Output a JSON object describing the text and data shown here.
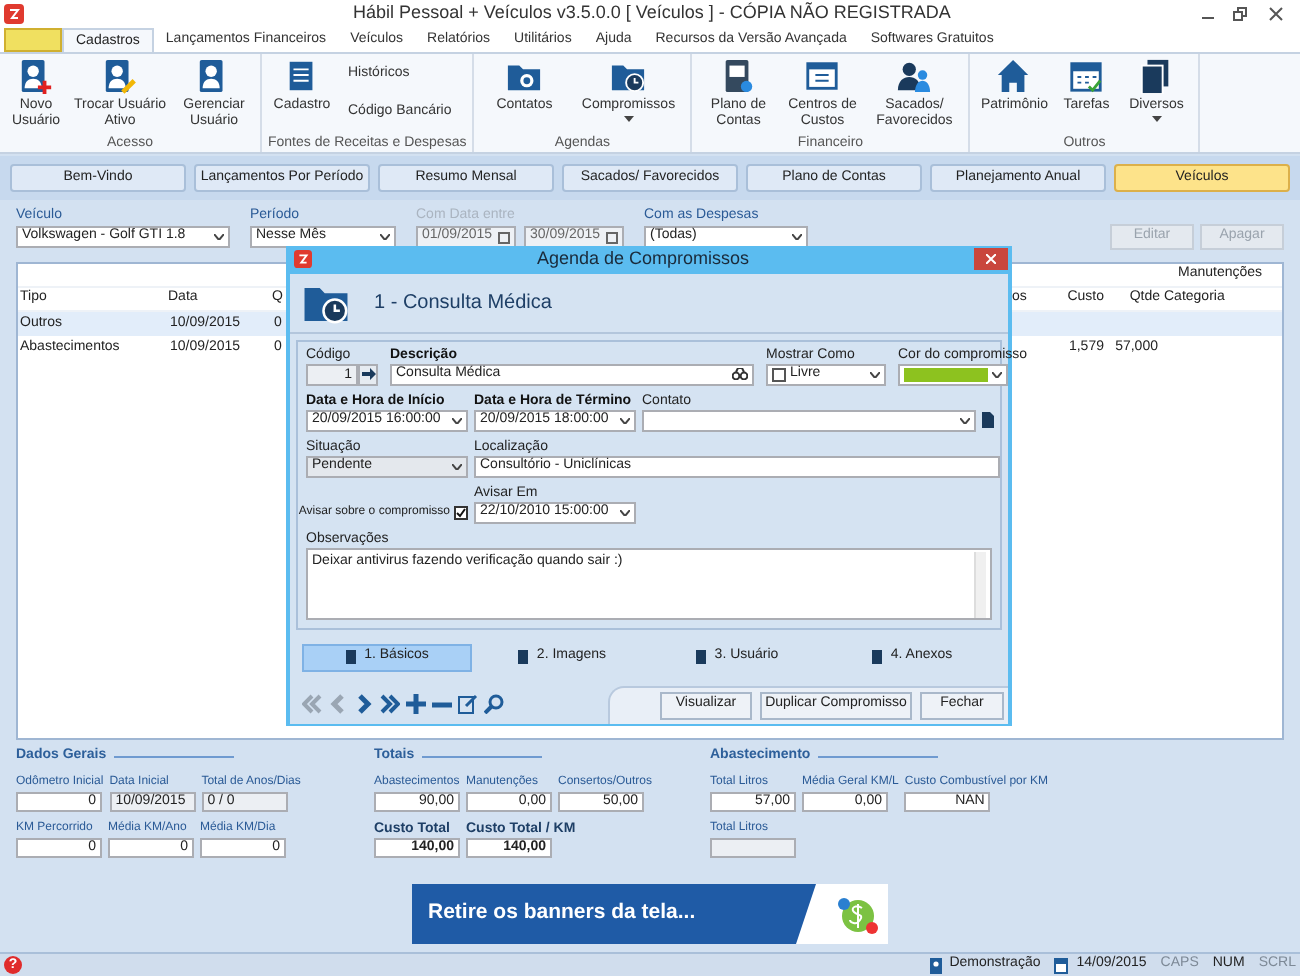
{
  "window": {
    "title": "Hábil Pessoal + Veículos v3.5.0.0 [ Veículos ] - CÓPIA NÃO REGISTRADA"
  },
  "ribbon_tabs": [
    {
      "label": "Cadastros",
      "selected": true
    },
    {
      "label": "Lançamentos Financeiros",
      "selected": false
    },
    {
      "label": "Veículos",
      "selected": false
    },
    {
      "label": "Relatórios",
      "selected": false
    },
    {
      "label": "Utilitários",
      "selected": false
    },
    {
      "label": "Ajuda",
      "selected": false
    },
    {
      "label": "Recursos da Versão Avançada",
      "selected": false
    },
    {
      "label": "Softwares Gratuitos",
      "selected": false
    }
  ],
  "ribbon_groups": [
    {
      "label": "Acesso",
      "buttons": [
        {
          "label": "Novo Usuário",
          "dropdown": false
        },
        {
          "label": "Trocar Usuário Ativo",
          "dropdown": false
        },
        {
          "label": "Gerenciar Usuário",
          "dropdown": false
        }
      ]
    },
    {
      "label": "Fontes de Receitas e Despesas",
      "buttons": [
        {
          "label": "Cadastro",
          "dropdown": false
        }
      ],
      "small_buttons": [
        "Históricos",
        "Código Bancário"
      ]
    },
    {
      "label": "Agendas",
      "buttons": [
        {
          "label": "Contatos",
          "dropdown": false
        },
        {
          "label": "Compromissos",
          "dropdown": true
        }
      ]
    },
    {
      "label": "Financeiro",
      "buttons": [
        {
          "label": "Plano de Contas",
          "dropdown": false
        },
        {
          "label": "Centros de Custos",
          "dropdown": false
        },
        {
          "label": "Sacados/ Favorecidos",
          "dropdown": false
        }
      ]
    },
    {
      "label": "Outros",
      "buttons": [
        {
          "label": "Patrimônio",
          "dropdown": false
        },
        {
          "label": "Tarefas",
          "dropdown": false
        },
        {
          "label": "Diversos",
          "dropdown": true
        }
      ]
    }
  ],
  "nav_buttons": [
    {
      "label": "Bem-Vindo",
      "selected": false
    },
    {
      "label": "Lançamentos Por Período",
      "selected": false
    },
    {
      "label": "Resumo Mensal",
      "selected": false
    },
    {
      "label": "Sacados/ Favorecidos",
      "selected": false
    },
    {
      "label": "Plano de Contas",
      "selected": false
    },
    {
      "label": "Planejamento Anual",
      "selected": false
    },
    {
      "label": "Veículos",
      "selected": true
    }
  ],
  "filters": {
    "vehicle": {
      "label": "Veículo",
      "value": "Volkswagen - Golf GTI 1.8"
    },
    "period": {
      "label": "Período",
      "value": "Nesse Mês"
    },
    "date_range": {
      "label": "Com Data entre",
      "disabled": true,
      "from": "01/09/2015",
      "to": "30/09/2015"
    },
    "expenses": {
      "label": "Com as Despesas",
      "value": "(Todas)"
    }
  },
  "actions": [
    {
      "label": "Editar",
      "disabled": true
    },
    {
      "label": "Apagar",
      "disabled": true
    }
  ],
  "table": {
    "group_header": "Manutenções",
    "columns": {
      "tipo": "Tipo",
      "data": "Data",
      "column_3": "Q",
      "column_4": "os",
      "custo": "Custo",
      "qtde": "Qtde",
      "categoria": "Categoria"
    },
    "rows": [
      {
        "selected": true,
        "tipo": "Outros",
        "data": "10/09/2015",
        "column_3": "0"
      },
      {
        "selected": false,
        "tipo": "Abastecimentos",
        "data": "10/09/2015",
        "column_3": "0",
        "custo": "1,579",
        "qtde": "57,000"
      }
    ]
  },
  "dialog": {
    "title": "Agenda de Compromissos",
    "heading": "1 - Consulta Médica",
    "codigo": {
      "label": "Código",
      "value": "1"
    },
    "descricao": {
      "label": "Descrição",
      "value": "Consulta Médica"
    },
    "mostrar_como": {
      "label": "Mostrar Como",
      "value": "Livre"
    },
    "cor": {
      "label": "Cor do compromisso",
      "color": "#8dc21f"
    },
    "inicio": {
      "label": "Data e Hora de Início",
      "value": "20/09/2015 16:00:00"
    },
    "termino": {
      "label": "Data e Hora de Término",
      "value": "20/09/2015 18:00:00"
    },
    "contato": {
      "label": "Contato"
    },
    "situacao": {
      "label": "Situação",
      "value": "Pendente"
    },
    "localizacao": {
      "label": "Localização",
      "value": "Consultório - Uniclínicas"
    },
    "avisar": {
      "label": "Avisar sobre o compromisso",
      "checked": true
    },
    "avisar_em": {
      "label": "Avisar Em",
      "value": "22/10/2010 15:00:00"
    },
    "observacoes": {
      "label": "Observações",
      "value": "Deixar antivirus fazendo verificação quando sair :)"
    },
    "tabs": [
      {
        "label": "1. Básicos",
        "selected": true
      },
      {
        "label": "2. Imagens",
        "selected": false
      },
      {
        "label": "3. Usuário",
        "selected": false
      },
      {
        "label": "4. Anexos",
        "selected": false
      }
    ],
    "navigator": {
      "back_disabled": true
    },
    "buttons": [
      "Visualizar",
      "Duplicar Compromisso",
      "Fechar"
    ]
  },
  "summary": [
    {
      "title": "Dados Gerais",
      "rows": [
        [
          {
            "label": "Odômetro Inicial",
            "value": "0",
            "readonly": false,
            "kind": "normal"
          },
          {
            "label": "Data Inicial",
            "value": "10/09/2015",
            "readonly": true,
            "kind": "normal"
          },
          {
            "label": "Total de Anos/Dias",
            "value": "0 / 0",
            "readonly": true,
            "kind": "normal"
          }
        ],
        [
          {
            "label": "KM Percorrido",
            "value": "0",
            "readonly": false,
            "kind": "normal"
          },
          {
            "label": "Média KM/Ano",
            "value": "0",
            "readonly": false,
            "kind": "normal"
          },
          {
            "label": "Média KM/Dia",
            "value": "0",
            "readonly": false,
            "kind": "normal"
          }
        ]
      ]
    },
    {
      "title": "Totais",
      "rows": [
        [
          {
            "label": "Abastecimentos",
            "value": "90,00",
            "readonly": false,
            "kind": "normal"
          },
          {
            "label": "Manutenções",
            "value": "0,00",
            "readonly": false,
            "kind": "normal"
          },
          {
            "label": "Consertos/Outros",
            "value": "50,00",
            "readonly": false,
            "kind": "normal"
          }
        ],
        [
          {
            "label": "Custo Total",
            "value": "140,00",
            "readonly": false,
            "kind": "total"
          },
          {
            "label": "Custo Total / KM",
            "value": "140,00",
            "readonly": false,
            "kind": "total"
          }
        ]
      ]
    },
    {
      "title": "Abastecimento",
      "rows": [
        [
          {
            "label": "Total Litros",
            "value": "57,00",
            "readonly": false,
            "kind": "normal"
          },
          {
            "label": "Média Geral KM/L",
            "value": "0,00",
            "readonly": false,
            "kind": "normal"
          },
          {
            "label": "Custo Combustível por KM",
            "value": "NAN",
            "readonly": false,
            "kind": "normal"
          }
        ],
        [
          {
            "label": "Total Litros",
            "readonly": true,
            "kind": "normal"
          }
        ]
      ]
    }
  ],
  "banner": {
    "text": "Retire os banners da tela..."
  },
  "status_bar": {
    "help": "?",
    "user": "Demonstração",
    "date": "14/09/2015",
    "keys": [
      {
        "label": "CAPS",
        "on": false
      },
      {
        "label": "NUM",
        "on": true
      },
      {
        "label": "SCRL",
        "on": false
      }
    ]
  }
}
